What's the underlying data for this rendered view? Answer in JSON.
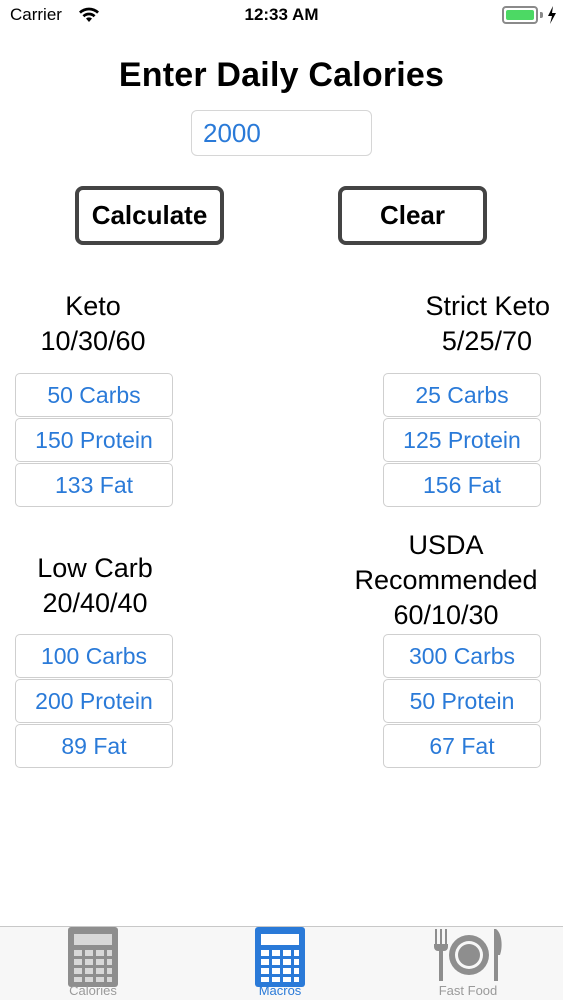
{
  "status": {
    "carrier": "Carrier",
    "time": "12:33 AM"
  },
  "header": {
    "title": "Enter Daily Calories"
  },
  "calories_input": {
    "value": "2000"
  },
  "buttons": {
    "calculate": "Calculate",
    "clear": "Clear"
  },
  "diets": [
    {
      "name": "Keto",
      "ratio": "10/30/60",
      "carbs": "50 Carbs",
      "protein": "150 Protein",
      "fat": "133 Fat"
    },
    {
      "name": "Strict Keto",
      "ratio": "5/25/70",
      "carbs": "25 Carbs",
      "protein": "125 Protein",
      "fat": "156 Fat"
    },
    {
      "name": "Low Carb",
      "ratio": "20/40/40",
      "carbs": "100 Carbs",
      "protein": "200 Protein",
      "fat": "89 Fat"
    },
    {
      "name_line1": "USDA",
      "name_line2": "Recommended",
      "ratio": "60/10/30",
      "carbs": "300 Carbs",
      "protein": "50 Protein",
      "fat": "67 Fat"
    }
  ],
  "tabs": [
    {
      "label": "Calories",
      "icon": "calculator-icon",
      "active": false
    },
    {
      "label": "Macros",
      "icon": "calculator-icon",
      "active": true
    },
    {
      "label": "Fast Food",
      "icon": "fork-plate-knife-icon",
      "active": false
    }
  ],
  "colors": {
    "accent": "#2a7ad8",
    "battery": "#4cd964",
    "inactive_tab": "#9a9a9a"
  }
}
